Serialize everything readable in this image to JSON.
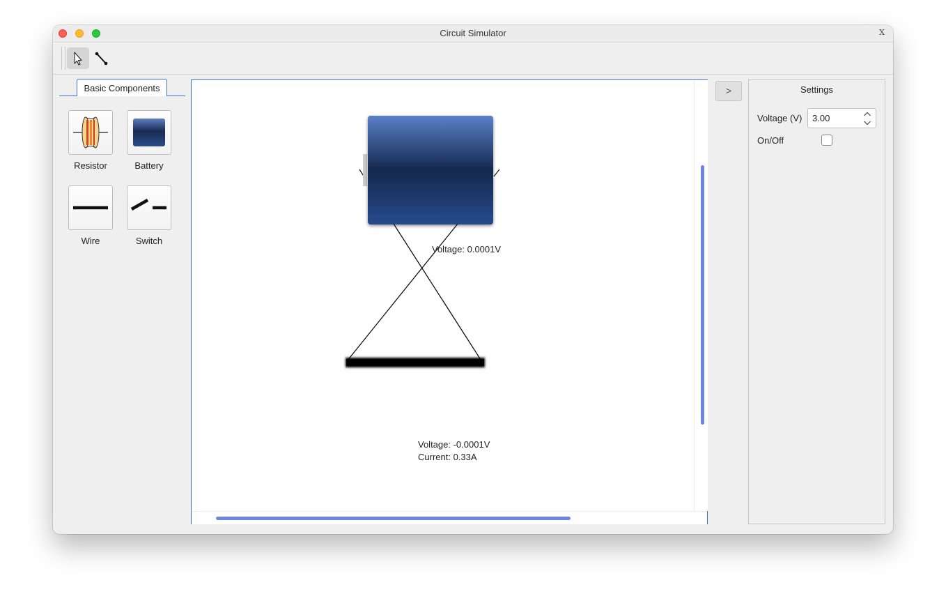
{
  "window": {
    "title": "Circuit Simulator",
    "corner_badge": "X"
  },
  "toolbar": {
    "tools": [
      {
        "name": "select",
        "icon": "arrow-pointer-icon",
        "active": true
      },
      {
        "name": "wire",
        "icon": "wire-connect-icon",
        "active": false
      }
    ]
  },
  "palette": {
    "tab_label": "Basic Components",
    "components": [
      {
        "label": "Resistor",
        "icon": "resistor-icon"
      },
      {
        "label": "Battery",
        "icon": "battery-icon"
      },
      {
        "label": "Wire",
        "icon": "wire-icon"
      },
      {
        "label": "Switch",
        "icon": "switch-icon"
      }
    ]
  },
  "canvas": {
    "battery_voltage_label": "Voltage: 0.0001V",
    "wire_voltage_label": "Voltage: -0.0001V",
    "wire_current_label": "Current: 0.33A"
  },
  "expander": {
    "label": ">"
  },
  "settings": {
    "title": "Settings",
    "voltage_label": "Voltage (V)",
    "voltage_value": "3.00",
    "onoff_label": "On/Off",
    "onoff_checked": false
  },
  "colors": {
    "accent": "#3d6fd0",
    "scrollbar": "#6d86e6",
    "battery_blue": "#1f3f73"
  }
}
